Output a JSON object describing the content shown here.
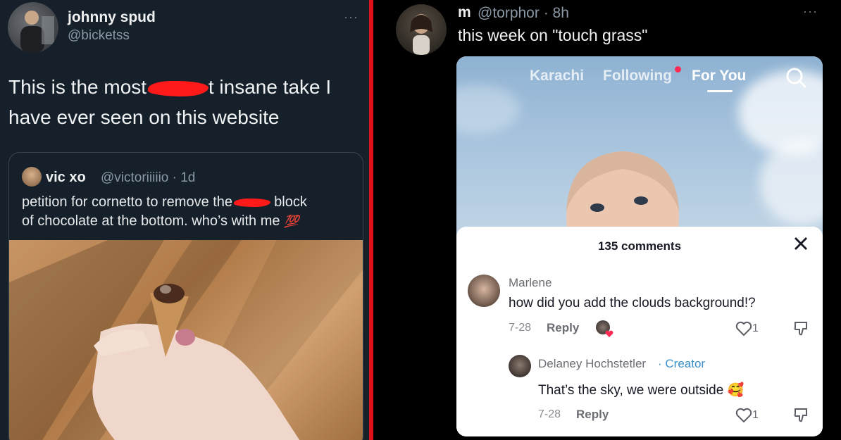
{
  "left_tweet": {
    "author_name": "johnny spud",
    "author_handle": "@bicketss",
    "more_label": "···",
    "text_line1_before": "This is the most ",
    "text_line1_after": "t insane take I",
    "text_line2": "have ever seen on this website",
    "quote": {
      "author_name": "vic xo",
      "author_handle": "@victoriiiiio · 1d",
      "text_line1_before": "petition for cornetto to remove the ",
      "text_line1_after": " block",
      "text_line2": "of chocolate at the bottom. who’s with me",
      "emoji": "💯"
    }
  },
  "right_tweet": {
    "author_name": "m",
    "author_handle": "@torphor · 8h",
    "more_label": "···",
    "text": "this week on \"touch grass\"",
    "tiktok": {
      "tabs": [
        {
          "label": "Karachi"
        },
        {
          "label": "Following"
        },
        {
          "label": "For You"
        }
      ],
      "comments_count": "135 comments",
      "comments": [
        {
          "user": "Marlene",
          "text": "how did you add the clouds background!?",
          "date": "7-28",
          "reply_label": "Reply",
          "likes": "1"
        },
        {
          "user": "Delaney Hochstetler",
          "badge": "Creator",
          "text": "That’s the sky, we were outside",
          "emoji": "🥰",
          "date": "7-28",
          "reply_label": "Reply",
          "likes": "1"
        }
      ]
    }
  },
  "colors": {
    "left_bg": "#15202b",
    "divider": "#e01018",
    "tiktok_accent": "#fe2c55",
    "creator_badge": "#3b8ec8"
  },
  "icons": [
    "search-icon",
    "close-icon",
    "heart-icon",
    "dislike-icon",
    "more-icon"
  ]
}
